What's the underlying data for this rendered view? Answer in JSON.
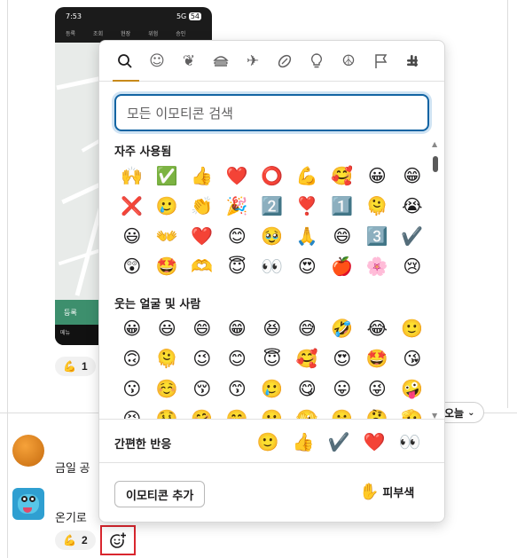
{
  "phone": {
    "time": "7:53",
    "signal": "5G",
    "battery": "54",
    "tabs": [
      "등록",
      "조회",
      "현장",
      "위험",
      "승인"
    ],
    "button_text": "등록",
    "bottom_text": "메뉴"
  },
  "messages": {
    "first_reaction": {
      "emoji": "💪",
      "count": "1"
    },
    "msg1_text": "금일 공",
    "msg2_text": "온기로",
    "second_reaction": {
      "emoji": "💪",
      "count": "2"
    }
  },
  "date_pill": {
    "label": "오늘",
    "chevron": "⌄"
  },
  "picker": {
    "categories": [
      {
        "name": "search",
        "glyph": "⌕"
      },
      {
        "name": "smileys",
        "glyph": "☺"
      },
      {
        "name": "nature",
        "glyph": "❦"
      },
      {
        "name": "food",
        "glyph": "🍔"
      },
      {
        "name": "travel",
        "glyph": "✈"
      },
      {
        "name": "activity",
        "glyph": "⚽"
      },
      {
        "name": "objects",
        "glyph": "💡"
      },
      {
        "name": "symbols",
        "glyph": "☮"
      },
      {
        "name": "flags",
        "glyph": "⚐"
      },
      {
        "name": "custom",
        "glyph": "✢"
      }
    ],
    "search_placeholder": "모든 이모티콘 검색",
    "sections": [
      {
        "title": "자주 사용됨",
        "rows": [
          [
            "🙌",
            "✅",
            "👍",
            "❤️",
            "⭕",
            "💪",
            "🥰",
            "😀",
            "😁"
          ],
          [
            "❌",
            "🥲",
            "👏",
            "🎉",
            "2️⃣",
            "❣️",
            "1️⃣",
            "🫠",
            "😭"
          ],
          [
            "😃",
            "👐",
            "❤️",
            "😊",
            "🥹",
            "🙏",
            "😄",
            "3️⃣",
            "✔️"
          ],
          [
            "😲",
            "🤩",
            "🫶",
            "😇",
            "👀",
            "😍",
            "🍎",
            "🌸",
            "😢"
          ]
        ]
      },
      {
        "title": "웃는 얼굴 및 사람",
        "rows": [
          [
            "😀",
            "😃",
            "😄",
            "😁",
            "😆",
            "😅",
            "🤣",
            "😂",
            "🙂"
          ],
          [
            "🙃",
            "🫠",
            "😉",
            "😊",
            "😇",
            "🥰",
            "😍",
            "🤩",
            "😘"
          ],
          [
            "😗",
            "☺️",
            "😚",
            "😙",
            "🥲",
            "😋",
            "😛",
            "😜",
            "🤪"
          ],
          [
            "😝",
            "🤑",
            "🤗",
            "🤭",
            "🫢",
            "🫣",
            "🤫",
            "🤔",
            "🫡"
          ]
        ]
      }
    ],
    "quick_reactions": {
      "label": "간편한 반응",
      "emojis": [
        "🙂",
        "👍",
        "✔️",
        "❤️",
        "👀"
      ]
    },
    "add_emoji_label": "이모티콘 추가",
    "skin_tone": {
      "hand": "✋",
      "label": "피부색"
    }
  },
  "add_reaction_icon": "add-reaction"
}
